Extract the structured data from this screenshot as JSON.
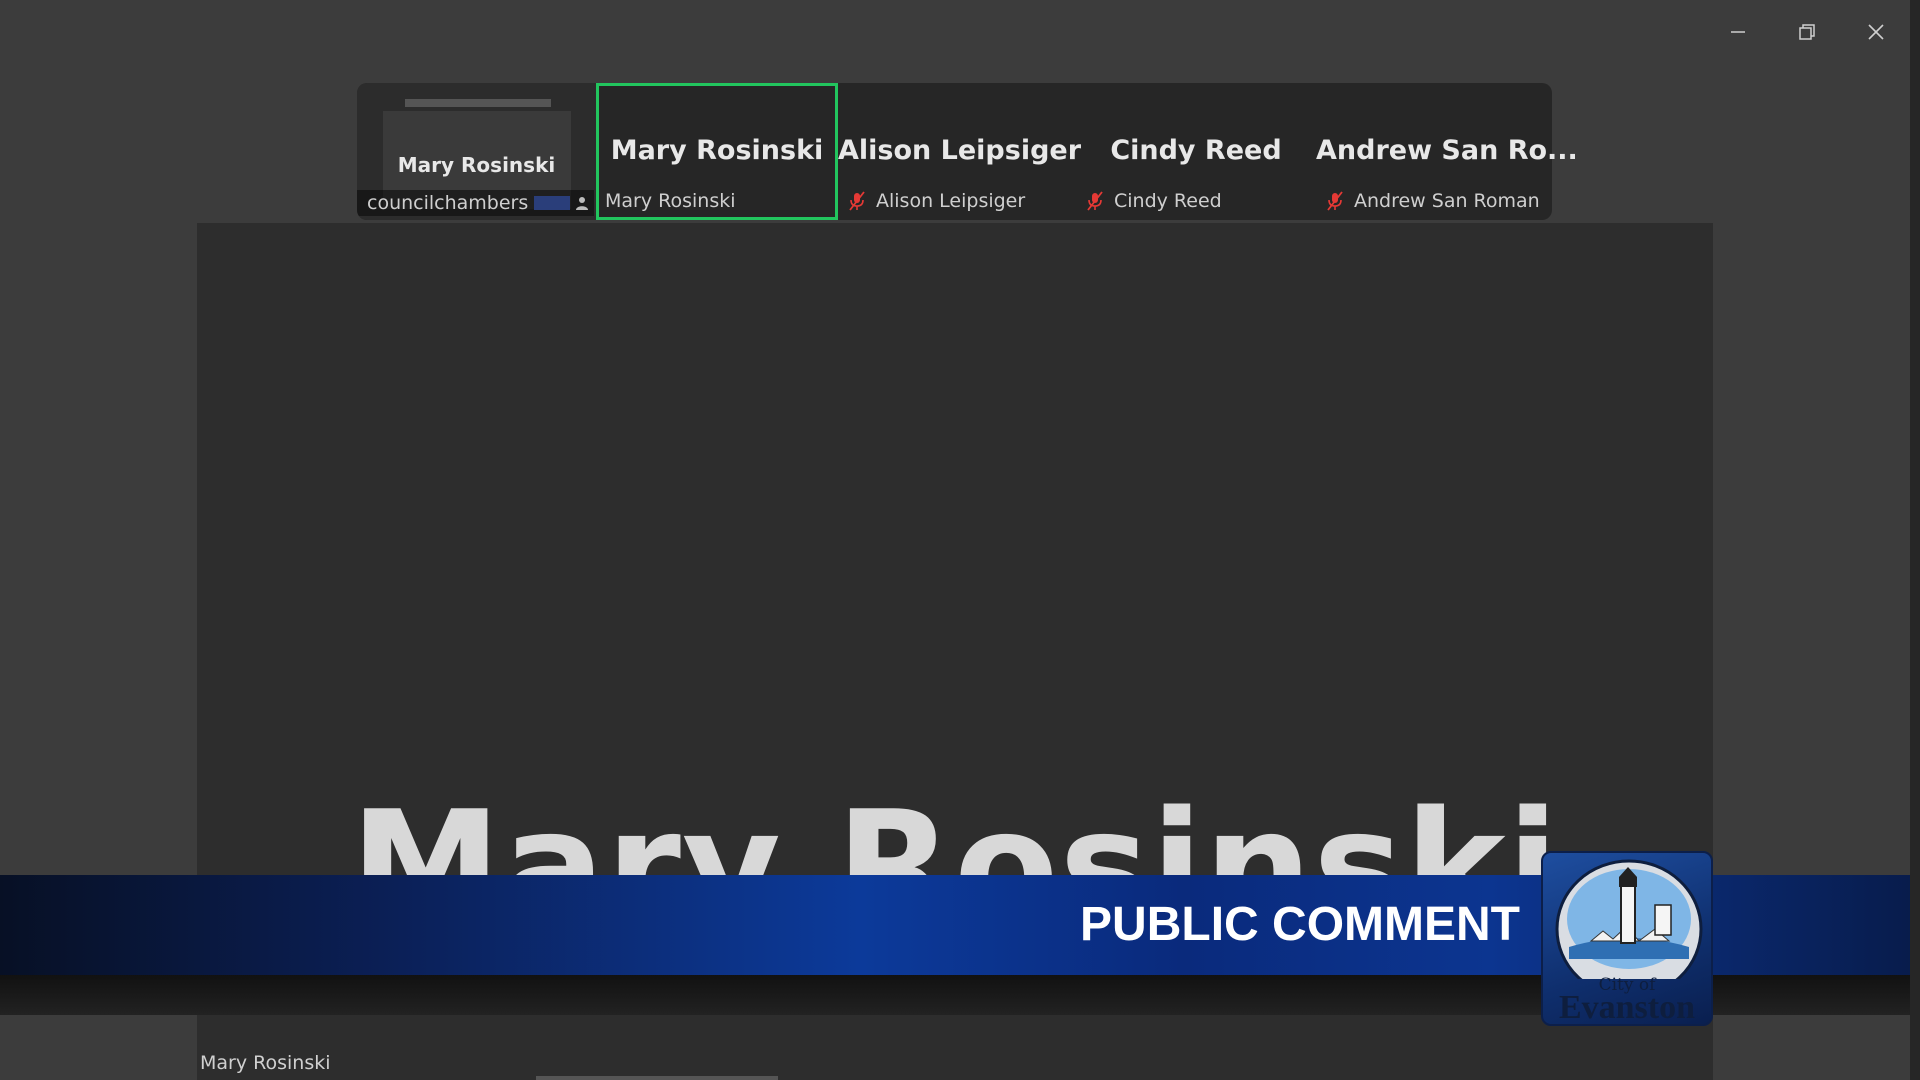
{
  "window_controls": {
    "minimize_icon": "minimize-icon",
    "restore_icon": "restore-icon",
    "close_icon": "close-icon"
  },
  "filmstrip": {
    "tiles": [
      {
        "name": "Mary Rosinski",
        "label": "councilchambers",
        "selected": false,
        "muted": false
      },
      {
        "name": "Mary Rosinski",
        "label": "Mary Rosinski",
        "selected": true,
        "muted": false
      },
      {
        "name": "Alison Leipsiger",
        "label": "Alison Leipsiger",
        "selected": false,
        "muted": true
      },
      {
        "name": "Cindy Reed",
        "label": "Cindy Reed",
        "selected": false,
        "muted": true
      },
      {
        "name": "Andrew  San  Ro...",
        "label": "Andrew San Roman",
        "selected": false,
        "muted": true
      }
    ],
    "selected_border_color": "#22c55e",
    "muted_icon_color": "#e53935"
  },
  "stage": {
    "speaker_name": "Mary Rosinski",
    "name_label": "Mary Rosinski"
  },
  "banner": {
    "title": "PUBLIC COMMENT",
    "logo_line1": "City of",
    "logo_line2": "Evanston"
  }
}
